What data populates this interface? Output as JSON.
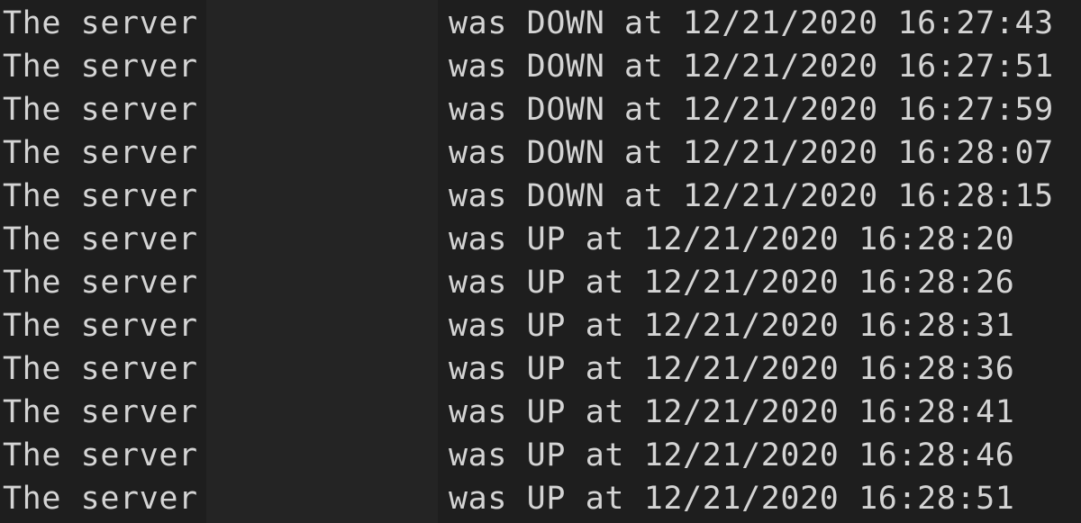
{
  "terminal": {
    "background_color": "#1e1e1e",
    "text_color": "#d4d4d4",
    "redaction_color": "#242424",
    "lines": [
      {
        "prefix": "The server",
        "message": "was DOWN at 12/21/2020 16:27:43"
      },
      {
        "prefix": "The server",
        "message": "was DOWN at 12/21/2020 16:27:51"
      },
      {
        "prefix": "The server",
        "message": "was DOWN at 12/21/2020 16:27:59"
      },
      {
        "prefix": "The server",
        "message": "was DOWN at 12/21/2020 16:28:07"
      },
      {
        "prefix": "The server",
        "message": "was DOWN at 12/21/2020 16:28:15"
      },
      {
        "prefix": "The server",
        "message": "was UP at 12/21/2020 16:28:20"
      },
      {
        "prefix": "The server",
        "message": "was UP at 12/21/2020 16:28:26"
      },
      {
        "prefix": "The server",
        "message": "was UP at 12/21/2020 16:28:31"
      },
      {
        "prefix": "The server",
        "message": "was UP at 12/21/2020 16:28:36"
      },
      {
        "prefix": "The server",
        "message": "was UP at 12/21/2020 16:28:41"
      },
      {
        "prefix": "The server",
        "message": "was UP at 12/21/2020 16:28:46"
      },
      {
        "prefix": "The server",
        "message": "was UP at 12/21/2020 16:28:51"
      }
    ]
  }
}
